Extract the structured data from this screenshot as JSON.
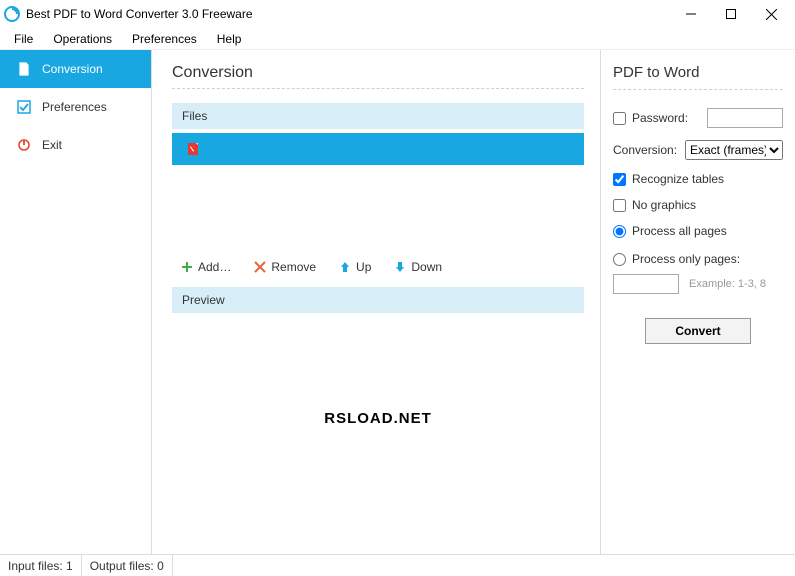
{
  "titlebar": {
    "title": "Best PDF to Word Converter 3.0 Freeware"
  },
  "menubar": {
    "file": "File",
    "operations": "Operations",
    "preferences": "Preferences",
    "help": "Help"
  },
  "sidebar": {
    "items": [
      {
        "label": "Conversion"
      },
      {
        "label": "Preferences"
      },
      {
        "label": "Exit"
      }
    ]
  },
  "main": {
    "heading": "Conversion",
    "files_header": "Files",
    "buttons": {
      "add": "Add…",
      "remove": "Remove",
      "up": "Up",
      "down": "Down"
    },
    "preview_header": "Preview",
    "preview_watermark": "RSLOAD.NET"
  },
  "right": {
    "heading": "PDF to Word",
    "password_label": "Password:",
    "password_value": "",
    "conversion_label": "Conversion:",
    "conversion_selected": "Exact (frames)",
    "recognize_tables": "Recognize tables",
    "no_graphics": "No graphics",
    "process_all": "Process all pages",
    "process_only": "Process only pages:",
    "pages_value": "",
    "pages_example": "Example: 1-3, 8",
    "convert": "Convert"
  },
  "status": {
    "input": "Input files: 1",
    "output": "Output files: 0"
  }
}
